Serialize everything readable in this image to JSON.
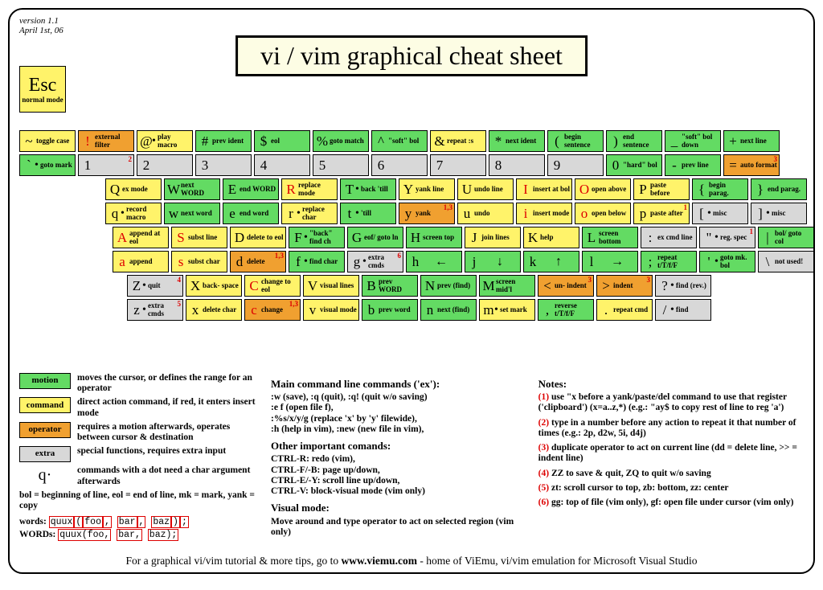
{
  "version_line1": "version 1.1",
  "version_line2": "April 1st, 06",
  "title": "vi / vim graphical cheat sheet",
  "esc": {
    "label": "Esc",
    "sub": "normal mode"
  },
  "rows": [
    [
      {
        "u": {
          "s": "~",
          "l": "toggle case",
          "c": "command"
        },
        "d": {
          "s": "`",
          "dot": true,
          "l": "goto mark",
          "c": "motion"
        }
      },
      {
        "u": {
          "s": "!",
          "l": "external filter",
          "c": "operator",
          "red": true
        },
        "d": {
          "s": "1",
          "sup": "2",
          "c": "extra"
        }
      },
      {
        "u": {
          "s": "@",
          "dot": true,
          "l": "play macro",
          "c": "command"
        },
        "d": {
          "s": "2",
          "c": "extra"
        }
      },
      {
        "u": {
          "s": "#",
          "l": "prev ident",
          "c": "motion"
        },
        "d": {
          "s": "3",
          "c": "extra"
        }
      },
      {
        "u": {
          "s": "$",
          "l": "eol",
          "c": "motion"
        },
        "d": {
          "s": "4",
          "c": "extra"
        }
      },
      {
        "u": {
          "s": "%",
          "l": "goto match",
          "c": "motion"
        },
        "d": {
          "s": "5",
          "c": "extra"
        }
      },
      {
        "u": {
          "s": "^",
          "l": "\"soft\" bol",
          "c": "motion"
        },
        "d": {
          "s": "6",
          "c": "extra"
        }
      },
      {
        "u": {
          "s": "&",
          "l": "repeat :s",
          "c": "command"
        },
        "d": {
          "s": "7",
          "c": "extra"
        }
      },
      {
        "u": {
          "s": "*",
          "l": "next ident",
          "c": "motion"
        },
        "d": {
          "s": "8",
          "c": "extra"
        }
      },
      {
        "u": {
          "s": "(",
          "l": "begin sentence",
          "c": "motion"
        },
        "d": {
          "s": "9",
          "c": "extra"
        }
      },
      {
        "u": {
          "s": ")",
          "l": "end sentence",
          "c": "motion"
        },
        "d": {
          "s": "0",
          "l": "\"hard\" bol",
          "c": "motion"
        }
      },
      {
        "u": {
          "s": "_",
          "l": "\"soft\" bol down",
          "c": "motion"
        },
        "d": {
          "s": "-",
          "l": "prev line",
          "c": "motion"
        }
      },
      {
        "u": {
          "s": "+",
          "l": "next line",
          "c": "motion"
        },
        "d": {
          "s": "=",
          "l": "auto format",
          "c": "operator",
          "sup": "3"
        }
      }
    ],
    [
      {
        "u": {
          "s": "Q",
          "l": "ex mode",
          "c": "command"
        },
        "d": {
          "s": "q",
          "dot": true,
          "l": "record macro",
          "c": "command"
        }
      },
      {
        "u": {
          "s": "W",
          "l": "next WORD",
          "c": "motion"
        },
        "d": {
          "s": "w",
          "l": "next word",
          "c": "motion"
        }
      },
      {
        "u": {
          "s": "E",
          "l": "end WORD",
          "c": "motion"
        },
        "d": {
          "s": "e",
          "l": "end word",
          "c": "motion"
        }
      },
      {
        "u": {
          "s": "R",
          "l": "replace mode",
          "c": "command",
          "red": true
        },
        "d": {
          "s": "r",
          "dot": true,
          "l": "replace char",
          "c": "command"
        }
      },
      {
        "u": {
          "s": "T",
          "dot": true,
          "l": "back 'till",
          "c": "motion"
        },
        "d": {
          "s": "t",
          "dot": true,
          "l": "'till",
          "c": "motion"
        }
      },
      {
        "u": {
          "s": "Y",
          "l": "yank line",
          "c": "command"
        },
        "d": {
          "s": "y",
          "l": "yank",
          "c": "operator",
          "sup": "1,3"
        }
      },
      {
        "u": {
          "s": "U",
          "l": "undo line",
          "c": "command"
        },
        "d": {
          "s": "u",
          "l": "undo",
          "c": "command"
        }
      },
      {
        "u": {
          "s": "I",
          "l": "insert at bol",
          "c": "command",
          "red": true
        },
        "d": {
          "s": "i",
          "l": "insert mode",
          "c": "command",
          "red": true
        }
      },
      {
        "u": {
          "s": "O",
          "l": "open above",
          "c": "command",
          "red": true
        },
        "d": {
          "s": "o",
          "l": "open below",
          "c": "command",
          "red": true
        }
      },
      {
        "u": {
          "s": "P",
          "l": "paste before",
          "c": "command"
        },
        "d": {
          "s": "p",
          "l": "paste after",
          "c": "command",
          "sup": "1"
        }
      },
      {
        "u": {
          "s": "{",
          "l": "begin parag.",
          "c": "motion"
        },
        "d": {
          "s": "[",
          "dot": true,
          "l": "misc",
          "c": "extra"
        }
      },
      {
        "u": {
          "s": "}",
          "l": "end parag.",
          "c": "motion"
        },
        "d": {
          "s": "]",
          "dot": true,
          "l": "misc",
          "c": "extra"
        }
      }
    ],
    [
      {
        "u": {
          "s": "A",
          "l": "append at eol",
          "c": "command",
          "red": true
        },
        "d": {
          "s": "a",
          "l": "append",
          "c": "command",
          "red": true
        }
      },
      {
        "u": {
          "s": "S",
          "l": "subst line",
          "c": "command",
          "red": true
        },
        "d": {
          "s": "s",
          "l": "subst char",
          "c": "command",
          "red": true
        }
      },
      {
        "u": {
          "s": "D",
          "l": "delete to eol",
          "c": "command"
        },
        "d": {
          "s": "d",
          "l": "delete",
          "c": "operator",
          "sup": "1,3"
        }
      },
      {
        "u": {
          "s": "F",
          "dot": true,
          "l": "\"back\" find ch",
          "c": "motion"
        },
        "d": {
          "s": "f",
          "dot": true,
          "l": "find char",
          "c": "motion"
        }
      },
      {
        "u": {
          "s": "G",
          "l": "eof/ goto ln",
          "c": "motion"
        },
        "d": {
          "s": "g",
          "dot": true,
          "l": "extra cmds",
          "c": "extra",
          "sup": "6"
        }
      },
      {
        "u": {
          "s": "H",
          "l": "screen top",
          "c": "motion"
        },
        "d": {
          "s": "h",
          "arrow": "←",
          "c": "motion"
        }
      },
      {
        "u": {
          "s": "J",
          "l": "join lines",
          "c": "command"
        },
        "d": {
          "s": "j",
          "arrow": "↓",
          "c": "motion"
        }
      },
      {
        "u": {
          "s": "K",
          "l": "help",
          "c": "command"
        },
        "d": {
          "s": "k",
          "arrow": "↑",
          "c": "motion"
        }
      },
      {
        "u": {
          "s": "L",
          "l": "screen bottom",
          "c": "motion"
        },
        "d": {
          "s": "l",
          "arrow": "→",
          "c": "motion"
        }
      },
      {
        "u": {
          "s": ":",
          "l": "ex cmd line",
          "c": "extra"
        },
        "d": {
          "s": ";",
          "l": "repeat t/T/f/F",
          "c": "motion"
        }
      },
      {
        "u": {
          "s": "\"",
          "dot": true,
          "l": "reg. spec",
          "c": "extra",
          "sup": "1"
        },
        "d": {
          "s": "'",
          "dot": true,
          "l": "goto mk. bol",
          "c": "motion"
        }
      },
      {
        "u": {
          "s": "|",
          "l": "bol/ goto col",
          "c": "motion"
        },
        "d": {
          "s": "\\",
          "l": "not used!",
          "c": "extra"
        }
      }
    ],
    [
      {
        "u": {
          "s": "Z",
          "dot": true,
          "l": "quit",
          "c": "extra",
          "sup": "4"
        },
        "d": {
          "s": "z",
          "dot": true,
          "l": "extra cmds",
          "c": "extra",
          "sup": "5"
        }
      },
      {
        "u": {
          "s": "X",
          "l": "back- space",
          "c": "command"
        },
        "d": {
          "s": "x",
          "l": "delete char",
          "c": "command"
        }
      },
      {
        "u": {
          "s": "C",
          "l": "change to eol",
          "c": "command",
          "red": true
        },
        "d": {
          "s": "c",
          "l": "change",
          "c": "operator",
          "red": true,
          "sup": "1,3"
        }
      },
      {
        "u": {
          "s": "V",
          "l": "visual lines",
          "c": "command"
        },
        "d": {
          "s": "v",
          "l": "visual mode",
          "c": "command"
        }
      },
      {
        "u": {
          "s": "B",
          "l": "prev WORD",
          "c": "motion"
        },
        "d": {
          "s": "b",
          "l": "prev word",
          "c": "motion"
        }
      },
      {
        "u": {
          "s": "N",
          "l": "prev (find)",
          "c": "motion"
        },
        "d": {
          "s": "n",
          "l": "next (find)",
          "c": "motion"
        }
      },
      {
        "u": {
          "s": "M",
          "l": "screen mid'l",
          "c": "motion"
        },
        "d": {
          "s": "m",
          "dot": true,
          "l": "set mark",
          "c": "command"
        }
      },
      {
        "u": {
          "s": "<",
          "l": "un- indent",
          "c": "operator",
          "sup": "3"
        },
        "d": {
          "s": ",",
          "l": "reverse t/T/f/F",
          "c": "motion"
        }
      },
      {
        "u": {
          "s": ">",
          "l": "indent",
          "c": "operator",
          "sup": "3"
        },
        "d": {
          "s": ".",
          "l": "repeat cmd",
          "c": "command"
        }
      },
      {
        "u": {
          "s": "?",
          "dot": true,
          "l": "find (rev.)",
          "c": "extra"
        },
        "d": {
          "s": "/",
          "dot": true,
          "l": "find",
          "c": "extra"
        }
      }
    ]
  ],
  "legend": [
    {
      "label": "motion",
      "c": "motion",
      "text": "moves the cursor, or defines the range for an operator"
    },
    {
      "label": "command",
      "c": "command",
      "text": "direct action command, if red, it enters insert mode"
    },
    {
      "label": "operator",
      "c": "operator",
      "text": "requires a motion afterwards, operates between cursor & destination"
    },
    {
      "label": "extra",
      "c": "extra",
      "text": "special functions, requires extra input"
    }
  ],
  "q_example": "q·",
  "q_text": "commands with a dot need a char argument afterwards",
  "abbrev": "bol = beginning of line, eol = end of line, mk = mark, yank = copy",
  "words_label": "words:",
  "WORDS_label": "WORDs:",
  "words_ex": "quux(foo, bar, baz);",
  "col2": {
    "h1": "Main command line commands ('ex'):",
    "t1": ":w (save), :q (quit), :q! (quit w/o saving)\n:e f (open file f),\n:%s/x/y/g (replace 'x' by 'y' filewide),\n:h (help in vim), :new (new file in vim),",
    "h2": "Other important comands:",
    "t2": "CTRL-R: redo (vim),\nCTRL-F/-B: page up/down,\nCTRL-E/-Y: scroll line up/down,\nCTRL-V: block-visual mode (vim only)",
    "h3": "Visual mode:",
    "t3": "Move around and type operator to act on selected region (vim only)"
  },
  "notes_heading": "Notes:",
  "notes": [
    "use \"x before a yank/paste/del command to use that register ('clipboard') (x=a..z,*) (e.g.: \"ay$ to copy rest of line to reg 'a')",
    "type in a number before any action to repeat it that number of times (e.g.: 2p, d2w, 5i, d4j)",
    "duplicate operator to act on current line (dd = delete line, >> = indent line)",
    "ZZ to save & quit, ZQ to quit w/o saving",
    "zt: scroll cursor to top, zb: bottom, zz: center",
    "gg: top of file (vim only), gf: open file under cursor (vim only)"
  ],
  "footer_pre": "For a graphical vi/vim tutorial & more tips, go to  ",
  "footer_url": "www.viemu.com",
  "footer_post": "  - home of ViEmu, vi/vim emulation for Microsoft Visual Studio"
}
